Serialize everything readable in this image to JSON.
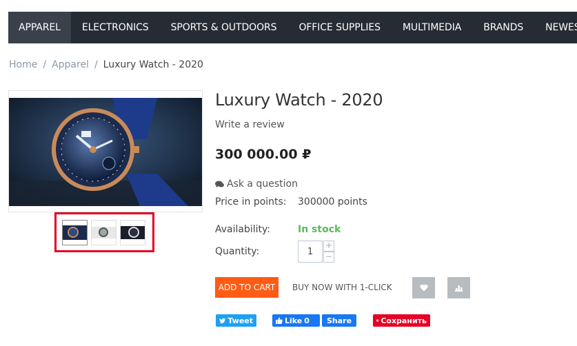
{
  "nav": {
    "items": [
      {
        "label": "APPAREL",
        "active": true
      },
      {
        "label": "ELECTRONICS",
        "active": false
      },
      {
        "label": "SPORTS & OUTDOORS",
        "active": false
      },
      {
        "label": "OFFICE SUPPLIES",
        "active": false
      },
      {
        "label": "MULTIMEDIA",
        "active": false
      },
      {
        "label": "BRANDS",
        "active": false
      },
      {
        "label": "NEWEST",
        "active": false
      }
    ]
  },
  "breadcrumb": {
    "home": "Home",
    "category": "Apparel",
    "current": "Luxury Watch - 2020",
    "separator": "/"
  },
  "product": {
    "title": "Luxury Watch - 2020",
    "review_link": "Write a review",
    "price": "300 000.00 ₽",
    "ask_question": "Ask a question",
    "points_label": "Price in points:",
    "points_value": "300000 points",
    "availability_label": "Availability:",
    "availability_value": "In stock",
    "quantity_label": "Quantity:",
    "quantity_value": "1",
    "qty_plus": "+",
    "qty_minus": "−"
  },
  "actions": {
    "add_to_cart": "ADD TO CART",
    "buy_now": "BUY NOW WITH 1-CLICK",
    "wishlist_icon": "heart-icon",
    "compare_icon": "bar-chart-icon"
  },
  "social": {
    "tweet": "Tweet",
    "like": "Like",
    "like_count": "0",
    "share": "Share",
    "pin": "Сохранить"
  },
  "colors": {
    "nav_bg": "#262c34",
    "accent": "#ff5b14",
    "in_stock": "#5cb85c",
    "highlight_box": "#e4001b"
  }
}
